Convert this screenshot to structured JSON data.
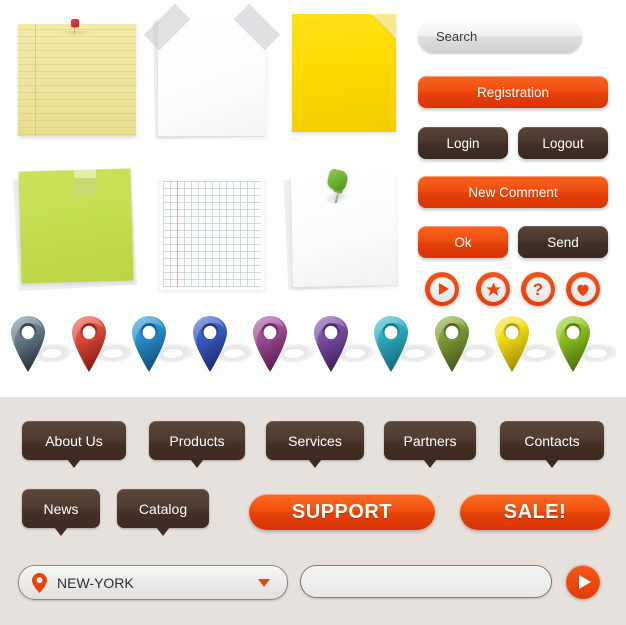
{
  "papers": [
    {
      "name": "yellow-lined-notepad",
      "pin_color": "#c41c24",
      "paper_color": "#eee59c",
      "label": "Yellow lined notepad with red pin"
    },
    {
      "name": "white-taped-sheet",
      "paper_color": "#ffffff",
      "tape_color": "#c4c8cc",
      "label": "White sheet with corner tape"
    },
    {
      "name": "yellow-sticky-note",
      "paper_color": "#fcd900",
      "label": "Yellow sticky note with curled corner"
    },
    {
      "name": "green-sticky-note",
      "paper_color": "#c3dd4f",
      "label": "Green sticky note with tape"
    },
    {
      "name": "graph-paper-sheet",
      "paper_color": "#fdfdfd",
      "grid_color": "#c4ced8",
      "margin_color": "#e2a0a0",
      "label": "Graph paper sheet"
    },
    {
      "name": "white-note-green-pin",
      "paper_color": "#ffffff",
      "pin_color": "#6cb02f",
      "label": "White note with green pushpin"
    }
  ],
  "buttons": {
    "search_label": "Search",
    "registration_label": "Registration",
    "login_label": "Login",
    "logout_label": "Logout",
    "new_comment_label": "New Comment",
    "ok_label": "Ok",
    "send_label": "Send"
  },
  "icon_buttons": [
    {
      "name": "play-icon",
      "glyph": "play"
    },
    {
      "name": "star-icon",
      "glyph": "star"
    },
    {
      "name": "question-icon",
      "glyph": "?"
    },
    {
      "name": "heart-icon",
      "glyph": "heart"
    }
  ],
  "map_pins": [
    {
      "name": "map-pin-slate",
      "color": "#6b7d8c",
      "dark": "#2b3740",
      "light": "#9eb0bd"
    },
    {
      "name": "map-pin-red",
      "color": "#dc4b3c",
      "dark": "#8c1d13",
      "light": "#f0837a"
    },
    {
      "name": "map-pin-blue",
      "color": "#2a8ec9",
      "dark": "#12557f",
      "light": "#6bbce8"
    },
    {
      "name": "map-pin-indigo",
      "color": "#3a5bc0",
      "dark": "#1d2f78",
      "light": "#7b94e0"
    },
    {
      "name": "map-pin-magenta",
      "color": "#9d4d92",
      "dark": "#5e2156",
      "light": "#c588bd"
    },
    {
      "name": "map-pin-purple",
      "color": "#7a4fa3",
      "dark": "#412460",
      "light": "#a886c8"
    },
    {
      "name": "map-pin-teal",
      "color": "#2eabc0",
      "dark": "#156d7d",
      "light": "#74d2e1"
    },
    {
      "name": "map-pin-olive",
      "color": "#7f9b3b",
      "dark": "#4a5c1c",
      "light": "#b3c878"
    },
    {
      "name": "map-pin-yellow",
      "color": "#efdb13",
      "dark": "#a89400",
      "light": "#f8ee7e"
    },
    {
      "name": "map-pin-lime",
      "color": "#8dc121",
      "dark": "#507409",
      "light": "#bedd74"
    }
  ],
  "nav": {
    "tabs": [
      {
        "label": "About Us",
        "name": "tab-about-us"
      },
      {
        "label": "Products",
        "name": "tab-products"
      },
      {
        "label": "Services",
        "name": "tab-services"
      },
      {
        "label": "Partners",
        "name": "tab-partners"
      },
      {
        "label": "Contacts",
        "name": "tab-contacts"
      },
      {
        "label": "News",
        "name": "tab-news"
      },
      {
        "label": "Catalog",
        "name": "tab-catalog"
      }
    ],
    "support_label": "SUPPORT",
    "sale_label": "SALE!"
  },
  "bottom_bar": {
    "city_value": "NEW-YORK",
    "search_placeholder": "",
    "search_value": "",
    "go_label": ""
  },
  "colors": {
    "orange": "#e8430b",
    "dark_brown": "#452f26",
    "panel_bg": "#e6e1dc",
    "page_bg": "#ffffff"
  }
}
